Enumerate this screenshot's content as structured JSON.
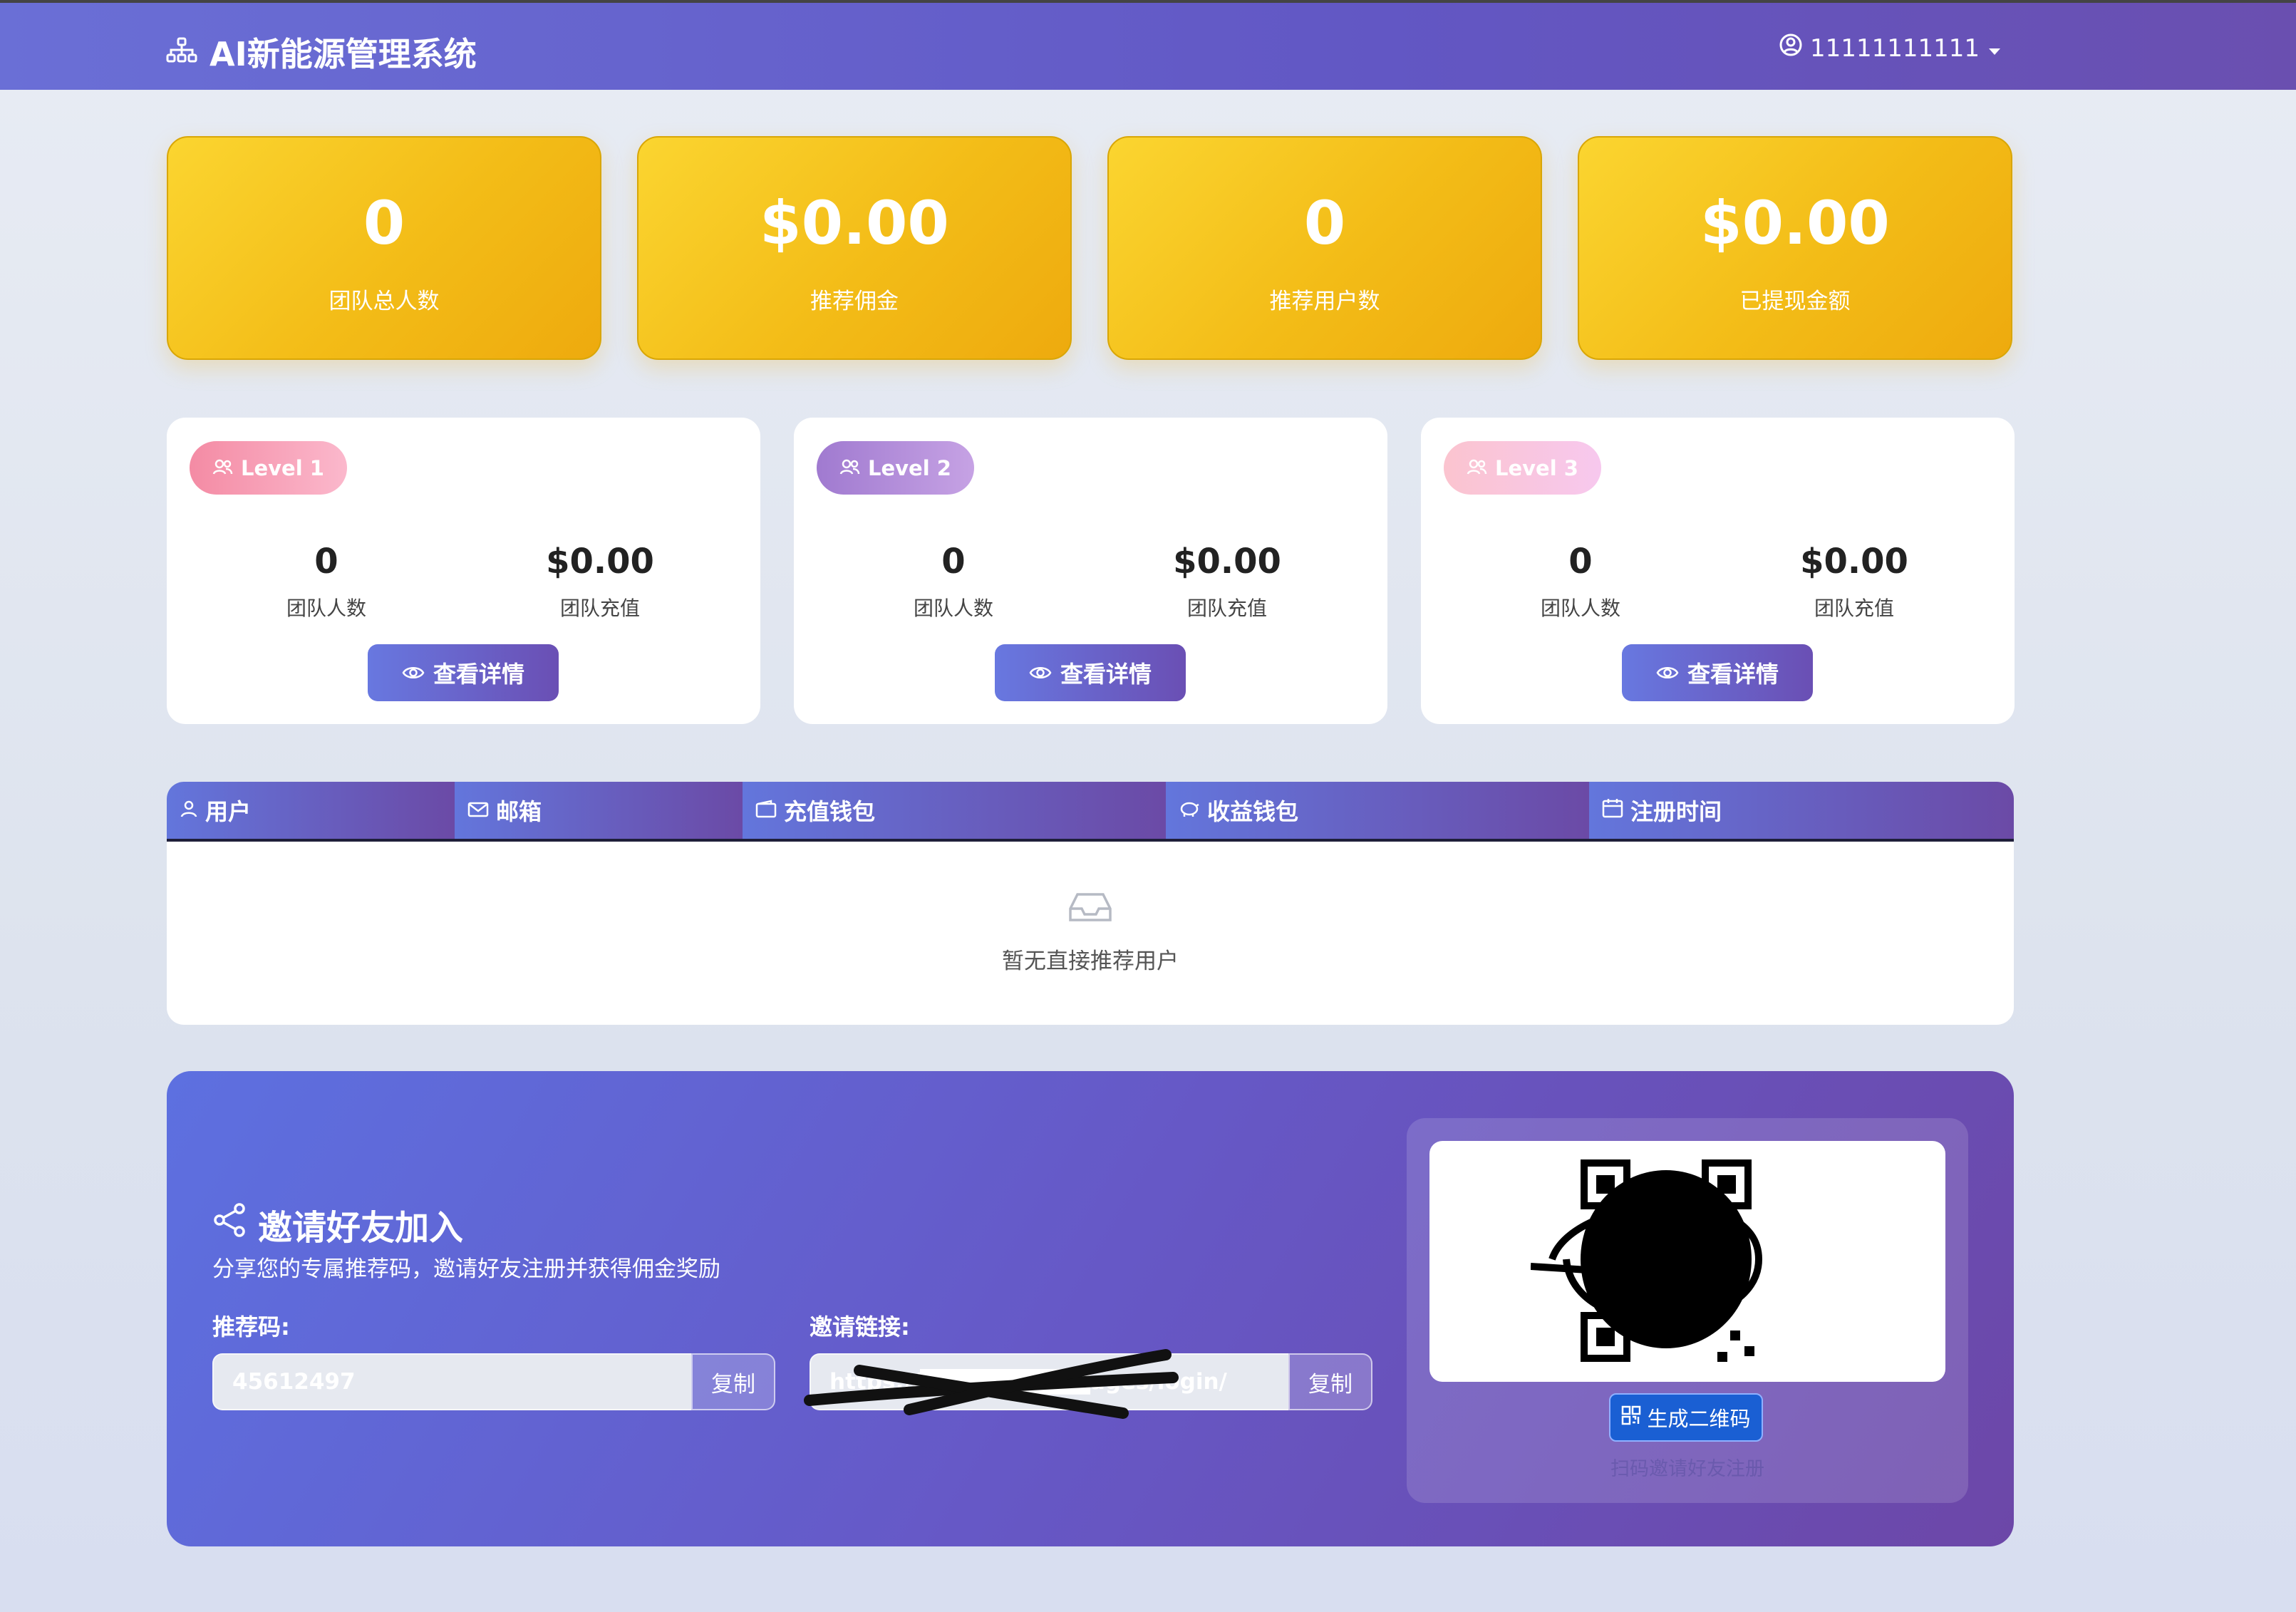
{
  "header": {
    "title": "AI新能源管理系统",
    "username": "11111111111"
  },
  "stats": [
    {
      "value": "0",
      "label": "团队总人数"
    },
    {
      "value": "$0.00",
      "label": "推荐佣金"
    },
    {
      "value": "0",
      "label": "推荐用户数"
    },
    {
      "value": "$0.00",
      "label": "已提现金额"
    }
  ],
  "levels": [
    {
      "badge": "Level 1",
      "count": "0",
      "count_label": "团队人数",
      "amount": "$0.00",
      "amount_label": "团队充值",
      "button": "查看详情",
      "color": "#f590a8"
    },
    {
      "badge": "Level 2",
      "count": "0",
      "count_label": "团队人数",
      "amount": "$0.00",
      "amount_label": "团队充值",
      "button": "查看详情",
      "color": "#b48ad6"
    },
    {
      "badge": "Level 3",
      "count": "0",
      "count_label": "团队人数",
      "amount": "$0.00",
      "amount_label": "团队充值",
      "button": "查看详情",
      "color": "#f7bcd2"
    }
  ],
  "table": {
    "columns": [
      "用户",
      "邮箱",
      "充值钱包",
      "收益钱包",
      "注册时间"
    ],
    "empty_text": "暂无直接推荐用户"
  },
  "invite": {
    "title": "邀请好友加入",
    "subtitle": "分享您的专属推荐码，邀请好友注册并获得佣金奖励",
    "code_label": "推荐码:",
    "code_value": "45612497",
    "link_label": "邀请链接:",
    "link_value": "https://██████████ages/login/",
    "copy": "复制",
    "qr_button": "生成二维码",
    "qr_hint": "扫码邀请好友注册"
  },
  "colors": {
    "accent": "#6257c4",
    "stat_gold": "#f3bc17",
    "qr_button": "#1a5fd3"
  }
}
